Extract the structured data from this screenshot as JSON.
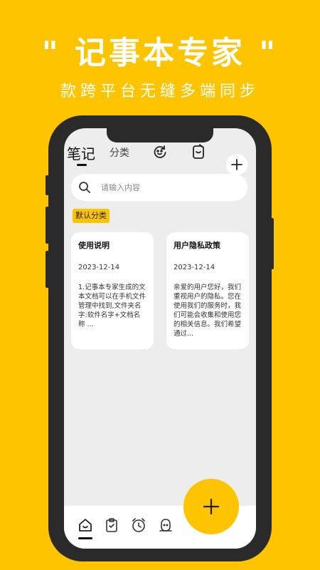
{
  "promo": {
    "title": "\" 记事本专家 \"",
    "subtitle": "款跨平台无缝多端同步"
  },
  "header": {
    "tab_notes": "笔记",
    "tab_category": "分类"
  },
  "search": {
    "placeholder": "请输入内容"
  },
  "category_badge": "默认分类",
  "notes": [
    {
      "title": "使用说明",
      "date": "2023-12-14",
      "body": "1.记事本专家生成的文本文档可以在手机文件管理中找到,文件夹名字:软件名字+文档名称 ..."
    },
    {
      "title": "用户隐私政策",
      "date": "2023-12-14",
      "body": "亲爱的用户您好，我们重视用户的隐私。您在使用我们的服务时，我们可能会收集和使用您的相关信息。我们希望通过..."
    }
  ],
  "colors": {
    "accent": "#FFC400",
    "phone": "#2a2a2a",
    "screen": "#EDEDED"
  },
  "icons": {
    "header": [
      "sync-icon",
      "edit-note-icon",
      "plus-icon"
    ],
    "nav": [
      "home-icon",
      "clipboard-icon",
      "clock-icon",
      "profile-icon"
    ],
    "fab": "plus-icon"
  }
}
